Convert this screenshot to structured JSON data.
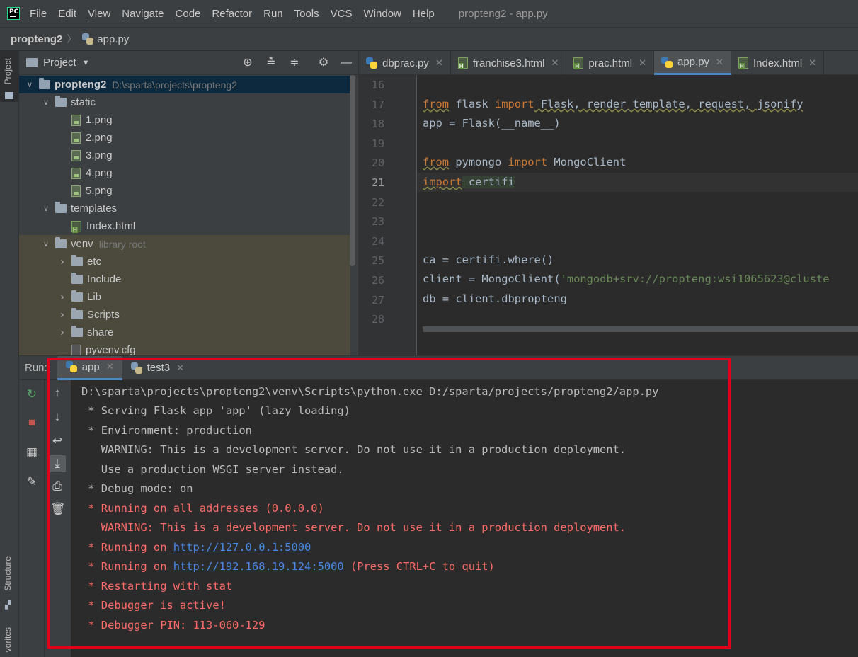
{
  "menubar": {
    "logo_text": "PC",
    "items": [
      "File",
      "Edit",
      "View",
      "Navigate",
      "Code",
      "Refactor",
      "Run",
      "Tools",
      "VCS",
      "Window",
      "Help"
    ],
    "underline": [
      "F",
      "E",
      "V",
      "N",
      "C",
      "R",
      "u",
      "T",
      "S",
      "W",
      "H"
    ],
    "window_title": "propteng2 - app.py"
  },
  "breadcrumb": {
    "project": "propteng2",
    "file": "app.py"
  },
  "left_strip": {
    "project_tab": "Project",
    "structure_tab": "Structure",
    "favorites_tab": "vorites"
  },
  "project_panel": {
    "title": "Project",
    "tree": [
      {
        "label": "propteng2",
        "path": "D:\\sparta\\projects\\propteng2",
        "type": "folder",
        "depth": 0,
        "expanded": true
      },
      {
        "label": "static",
        "type": "folder",
        "depth": 1,
        "expanded": true
      },
      {
        "label": "1.png",
        "type": "image",
        "depth": 2
      },
      {
        "label": "2.png",
        "type": "image",
        "depth": 2
      },
      {
        "label": "3.png",
        "type": "image",
        "depth": 2
      },
      {
        "label": "4.png",
        "type": "image",
        "depth": 2
      },
      {
        "label": "5.png",
        "type": "image",
        "depth": 2
      },
      {
        "label": "templates",
        "type": "folder",
        "depth": 1,
        "expanded": true
      },
      {
        "label": "Index.html",
        "type": "html",
        "depth": 2
      },
      {
        "label": "venv",
        "note": "library root",
        "type": "folder",
        "depth": 1,
        "expanded": true
      },
      {
        "label": "etc",
        "type": "folder",
        "depth": 2,
        "expanded": false
      },
      {
        "label": "Include",
        "type": "folder",
        "depth": 2
      },
      {
        "label": "Lib",
        "type": "folder",
        "depth": 2,
        "expanded": false
      },
      {
        "label": "Scripts",
        "type": "folder",
        "depth": 2,
        "expanded": false
      },
      {
        "label": "share",
        "type": "folder",
        "depth": 2,
        "expanded": false
      },
      {
        "label": "pyvenv.cfg",
        "type": "cfg",
        "depth": 2
      }
    ]
  },
  "editor": {
    "tabs": [
      {
        "label": "dbprac.py",
        "type": "py"
      },
      {
        "label": "franchise3.html",
        "type": "html"
      },
      {
        "label": "prac.html",
        "type": "html"
      },
      {
        "label": "app.py",
        "type": "py",
        "active": true
      },
      {
        "label": "Index.html",
        "type": "html"
      }
    ],
    "line_numbers": [
      "16",
      "17",
      "18",
      "19",
      "20",
      "21",
      "22",
      "23",
      "24",
      "25",
      "26",
      "27",
      "28"
    ],
    "current_line": "21",
    "code": {
      "l17_from": "from",
      "l17_mod": " flask ",
      "l17_import": "import",
      "l17_rest": " Flask, render_template, request, jsonify",
      "l18": "app = Flask(__name__)",
      "l20_from": "from",
      "l20_mod": " pymongo ",
      "l20_import": "import",
      "l20_rest": " MongoClient",
      "l21_import": "import",
      "l21_rest": " certifi",
      "l25": "ca = certifi.where()",
      "l26_pre": "client = MongoClient(",
      "l26_str": "'mongodb+srv://propteng:wsi1065623@cluste",
      "l27": "db = client.dbpropteng"
    }
  },
  "run_panel": {
    "label": "Run:",
    "tabs": [
      {
        "label": "app",
        "active": true
      },
      {
        "label": "test3"
      }
    ],
    "console": {
      "l1": "D:\\sparta\\projects\\propteng2\\venv\\Scripts\\python.exe D:/sparta/projects/propteng2/app.py",
      "l2": " * Serving Flask app 'app' (lazy loading)",
      "l3": " * Environment: production",
      "l4": "   WARNING: This is a development server. Do not use it in a production deployment.",
      "l5": "   Use a production WSGI server instead.",
      "l6": " * Debug mode: on",
      "l7": " * Running on all addresses (0.0.0.0)",
      "l8": "   WARNING: This is a development server. Do not use it in a production deployment.",
      "l9_pre": " * Running on ",
      "l9_link": "http://127.0.0.1:5000",
      "l10_pre": " * Running on ",
      "l10_link": "http://192.168.19.124:5000",
      "l10_post": " (Press CTRL+C to quit)",
      "l11": " * Restarting with stat",
      "l12": " * Debugger is active!",
      "l13": " * Debugger PIN: 113-060-129"
    }
  },
  "colors": {
    "highlight_box": "#e0001a",
    "accent": "#4a88c7"
  }
}
